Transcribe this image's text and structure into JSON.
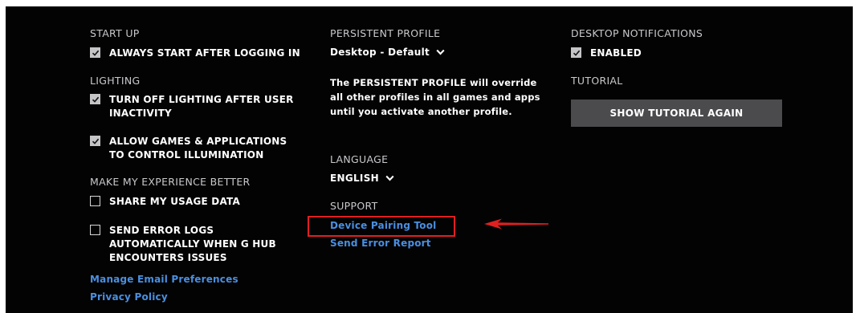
{
  "startup": {
    "heading": "START UP",
    "always_start": {
      "label": "ALWAYS START AFTER LOGGING IN",
      "checked": true
    }
  },
  "lighting": {
    "heading": "LIGHTING",
    "options": [
      {
        "label": "TURN OFF LIGHTING AFTER USER INACTIVITY",
        "checked": true
      },
      {
        "label": "ALLOW GAMES & APPLICATIONS TO CONTROL ILLUMINATION",
        "checked": true
      }
    ]
  },
  "experience": {
    "heading": "MAKE MY EXPERIENCE BETTER",
    "options": [
      {
        "label": "SHARE MY USAGE DATA",
        "checked": false
      },
      {
        "label": "SEND ERROR LOGS AUTOMATICALLY WHEN G HUB ENCOUNTERS ISSUES",
        "checked": false
      }
    ]
  },
  "links": {
    "manage_email": "Manage Email Preferences",
    "privacy_policy": "Privacy Policy"
  },
  "persistent_profile": {
    "heading": "PERSISTENT PROFILE",
    "selected": "Desktop - Default",
    "description": "The PERSISTENT PROFILE will override all other profiles in all games and apps until you activate another profile."
  },
  "language": {
    "heading": "LANGUAGE",
    "selected": "ENGLISH"
  },
  "support": {
    "heading": "SUPPORT",
    "device_pairing_tool": "Device Pairing Tool",
    "send_error_report": "Send Error Report"
  },
  "desktop_notifications": {
    "heading": "DESKTOP NOTIFICATIONS",
    "enabled": {
      "label": "ENABLED",
      "checked": true
    }
  },
  "tutorial": {
    "heading": "TUTORIAL",
    "button_label": "SHOW TUTORIAL AGAIN"
  },
  "annotation": {
    "highlight_color": "#e02020"
  }
}
